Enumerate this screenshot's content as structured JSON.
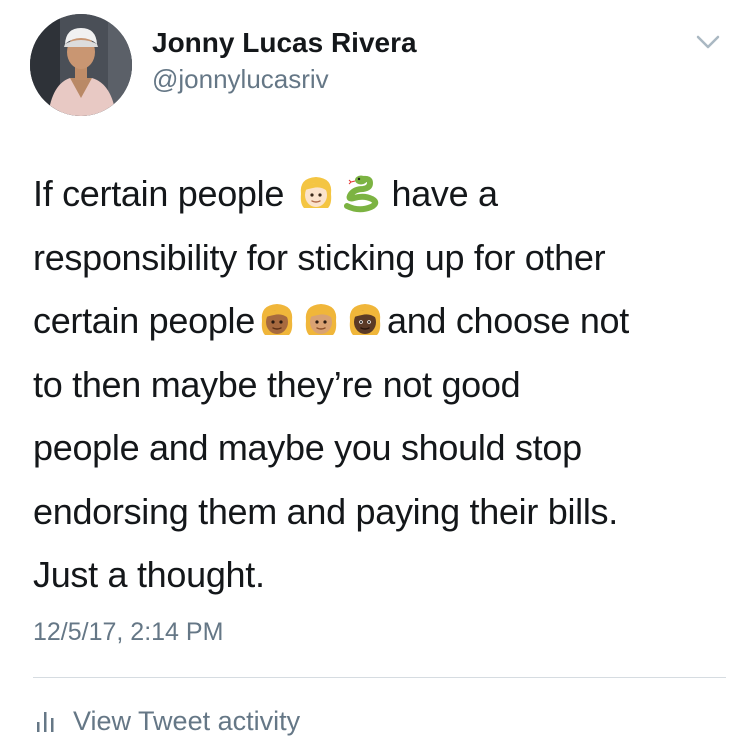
{
  "tweet": {
    "author": {
      "display_name": "Jonny Lucas Rivera",
      "handle": "@jonnylucasriv",
      "avatar_icon": "profile-photo"
    },
    "menu_icon": "chevron-down-icon",
    "text": {
      "line1_before": "If certain people",
      "line1_after": "have a",
      "line2": "responsibility for sticking up for other",
      "line3_before": "certain people",
      "line3_after": "and choose not",
      "line4": "to then maybe they’re not good",
      "line5": "people and maybe you should stop",
      "line6": "endorsing them and paying their bills.",
      "line7": "Just a thought."
    },
    "emoji": {
      "line1": [
        "woman-blond-hair-light-skin-emoji",
        "snake-emoji"
      ],
      "line3": [
        "woman-blond-hair-medium-dark-skin-emoji",
        "woman-blond-hair-medium-skin-emoji",
        "woman-blond-hair-dark-skin-emoji"
      ]
    },
    "timestamp": "12/5/17, 2:14 PM",
    "activity": {
      "icon": "bar-chart-icon",
      "label": "View Tweet activity"
    }
  },
  "colors": {
    "primary_text": "#14171a",
    "secondary_text": "#657786",
    "divider": "#d6dce1",
    "background": "#ffffff"
  }
}
